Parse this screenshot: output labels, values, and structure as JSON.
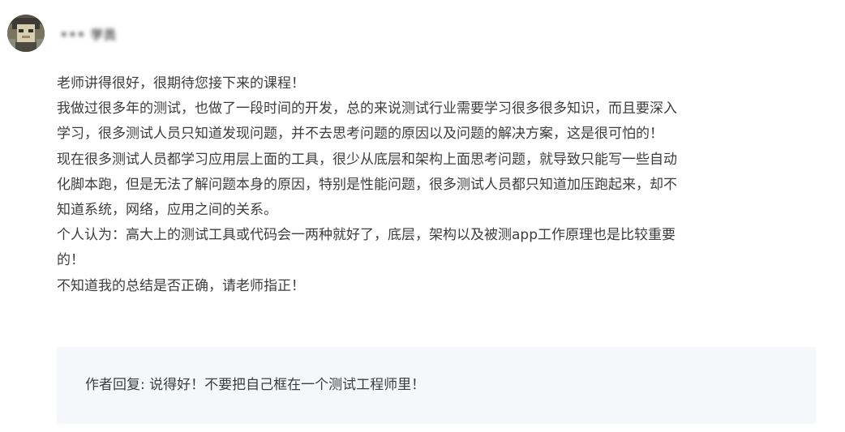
{
  "user": {
    "name": "••• 学员",
    "avatar_icon": "user-avatar-icon"
  },
  "comment": {
    "lines": [
      "老师讲得很好，很期待您接下来的课程！",
      "我做过很多年的测试，也做了一段时间的开发，总的来说测试行业需要学习很多很多知识，而且要深入",
      "学习，很多测试人员只知道发现问题，并不去思考问题的原因以及问题的解决方案，这是很可怕的！",
      "现在很多测试人员都学习应用层上面的工具，很少从底层和架构上面思考问题，就导致只能写一些自动",
      "化脚本跑，但是无法了解问题本身的原因，特别是性能问题，很多测试人员都只知道加压跑起来，却不",
      "知道系统，网络，应用之间的关系。",
      "个人认为：高大上的测试工具或代码会一两种就好了，底层，架构以及被测app工作原理也是比较重要",
      "的！",
      "不知道我的总结是否正确，请老师指正！"
    ]
  },
  "reply": {
    "text": "作者回复: 说得好！不要把自己框在一个测试工程师里！"
  },
  "colors": {
    "text": "#3d3d3d",
    "reply_bg": "#f6f7fb"
  }
}
